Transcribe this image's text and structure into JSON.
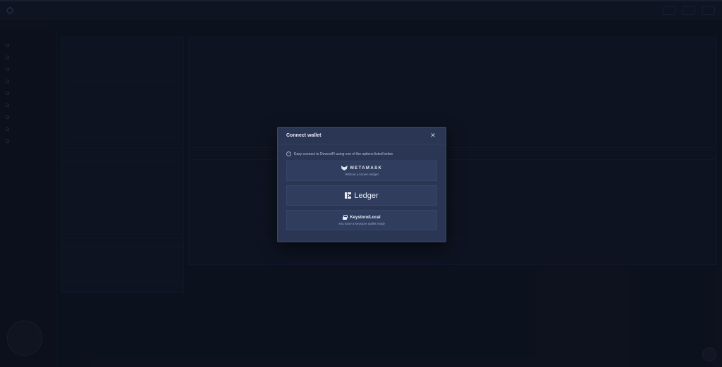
{
  "modal": {
    "title": "Connect wallet",
    "info": "Easy connect to DeversiFi using one of the options listed below",
    "options": [
      {
        "name": "METAMASK",
        "subtitle": "Without a known widget",
        "icon": "metamask-fox-icon"
      },
      {
        "name": "Ledger",
        "subtitle": "",
        "icon": "ledger-icon"
      },
      {
        "name": "Keystore/Local",
        "subtitle": "You have a keystore wallet ready",
        "icon": "lock-icon"
      }
    ],
    "close_icon": "close-icon"
  },
  "colors": {
    "modal_bg": "#2a3654",
    "option_bg": "#303d5e",
    "page_bg": "#131a2a"
  }
}
